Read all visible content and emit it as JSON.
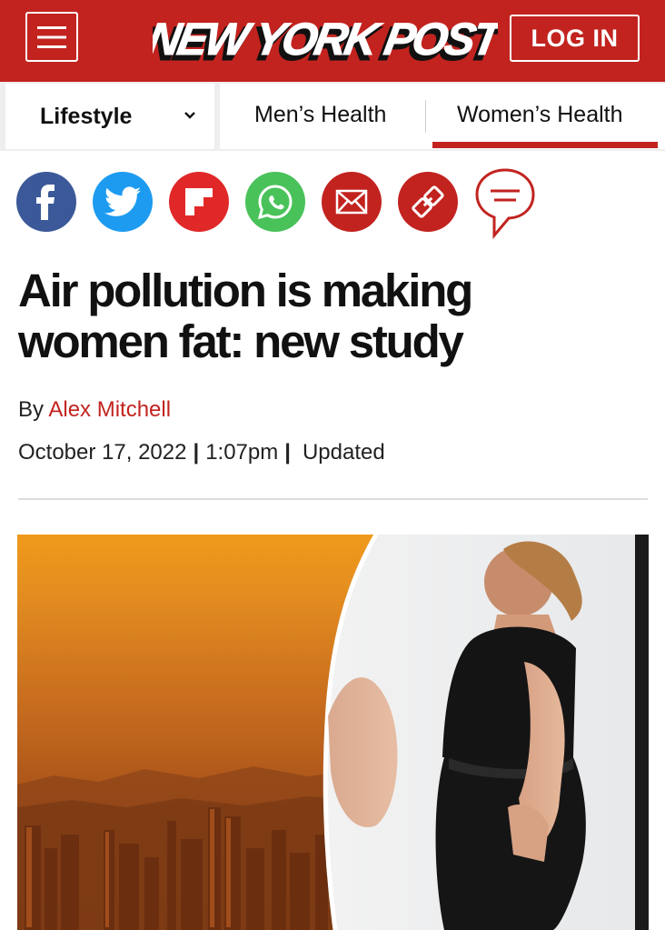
{
  "header": {
    "brand": "NEW YORK POST",
    "login_label": "LOG IN",
    "accent_color": "#c2231f"
  },
  "nav": {
    "section_label": "Lifestyle",
    "tabs": [
      {
        "label": "Men’s Health",
        "active": false
      },
      {
        "label": "Women’s Health",
        "active": true
      }
    ]
  },
  "share_icons": [
    {
      "name": "facebook-icon",
      "color": "#3b5998"
    },
    {
      "name": "twitter-icon",
      "color": "#1d9bf0"
    },
    {
      "name": "flipboard-icon",
      "color": "#e12828"
    },
    {
      "name": "whatsapp-icon",
      "color": "#49c25a"
    },
    {
      "name": "email-icon",
      "color": "#c2231f"
    },
    {
      "name": "copy-link-icon",
      "color": "#c2231f"
    },
    {
      "name": "comments-icon",
      "color": "#c2231f"
    }
  ],
  "article": {
    "headline": "Air pollution is making women fat: new study",
    "by_prefix": "By",
    "author": "Alex Mitchell",
    "date": "October 17, 2022",
    "time": "1:07pm",
    "updated_label": "Updated",
    "separator": "|"
  }
}
